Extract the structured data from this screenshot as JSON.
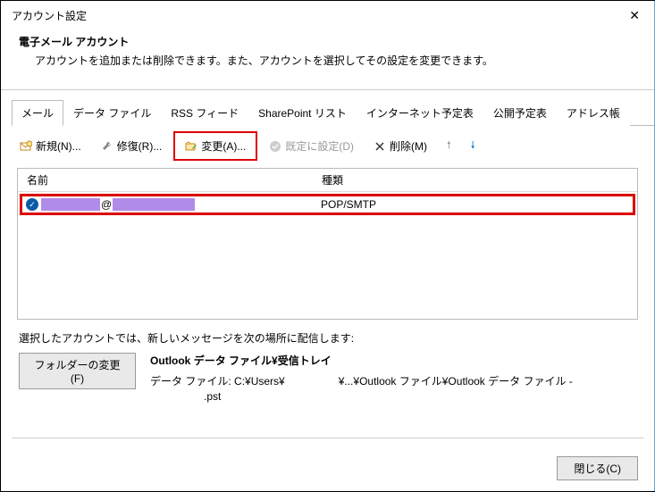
{
  "window": {
    "title": "アカウント設定"
  },
  "header": {
    "title": "電子メール アカウント",
    "description": "アカウントを追加または削除できます。また、アカウントを選択してその設定を変更できます。"
  },
  "tabs": [
    {
      "label": "メール",
      "active": true
    },
    {
      "label": "データ ファイル"
    },
    {
      "label": "RSS フィード"
    },
    {
      "label": "SharePoint リスト"
    },
    {
      "label": "インターネット予定表"
    },
    {
      "label": "公開予定表"
    },
    {
      "label": "アドレス帳"
    }
  ],
  "toolbar": {
    "new": "新規(N)...",
    "repair": "修復(R)...",
    "change": "変更(A)...",
    "setdefault": "既定に設定(D)",
    "delete": "削除(M)"
  },
  "list": {
    "columns": {
      "name": "名前",
      "type": "種類"
    },
    "rows": [
      {
        "at": "@",
        "type": "POP/SMTP"
      }
    ]
  },
  "delivery": {
    "info": "選択したアカウントでは、新しいメッセージを次の場所に配信します:",
    "change_folder": "フォルダーの変更(F)",
    "location_title": "Outlook データ ファイル¥受信トレイ",
    "location_path": "データ ファイル: C:¥Users¥　　　　　¥...¥Outlook ファイル¥Outlook データ ファイル - 　　　　　.pst"
  },
  "footer": {
    "close": "閉じる(C)"
  }
}
